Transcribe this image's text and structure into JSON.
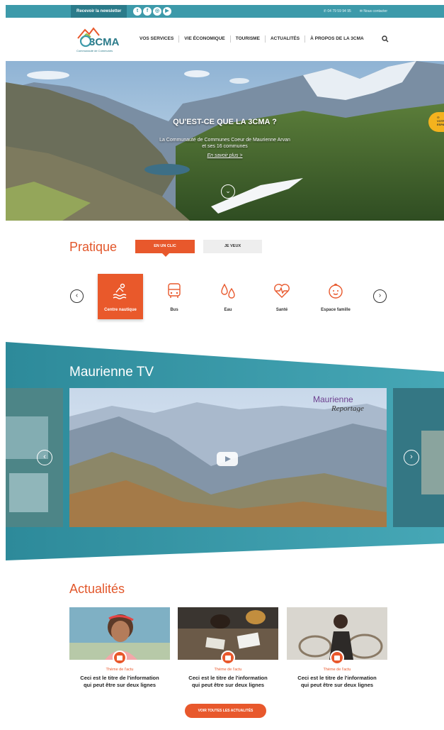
{
  "topbar": {
    "newsletter": "Recevoir la newsletter",
    "socials": [
      {
        "icon": "twitter-icon",
        "glyph": "t"
      },
      {
        "icon": "facebook-icon",
        "glyph": "f"
      },
      {
        "icon": "instagram-icon",
        "glyph": "◎"
      },
      {
        "icon": "youtube-icon",
        "glyph": "▶"
      }
    ],
    "phone": "04 79 59 94 95",
    "contact": "Nous contacter"
  },
  "header": {
    "logo_text": "3CMA",
    "logo_sub": "Communauté de Communes",
    "nav": [
      "VOS SERVICES",
      "VIE ÉCONOMIQUE",
      "TOURISME",
      "ACTUALITÉS",
      "À PROPOS DE LA 3CMA"
    ]
  },
  "hero": {
    "title": "QU'EST-CE QUE LA 3CMA ?",
    "text_line1": "La Communauté de Communes Coeur de Maurienne Arvan",
    "text_line2": "et ses 16 communes",
    "link": "En savoir plus >",
    "espace_label": "VOTRE ESPACE"
  },
  "pratique": {
    "title": "Pratique",
    "tab_active": "EN UN CLIC",
    "tab_other": "JE VEUX",
    "services": [
      {
        "label": "Centre nautique",
        "icon": "swimmer-icon",
        "active": true
      },
      {
        "label": "Bus",
        "icon": "bus-icon",
        "active": false
      },
      {
        "label": "Eau",
        "icon": "water-drops-icon",
        "active": false
      },
      {
        "label": "Santé",
        "icon": "heart-pulse-icon",
        "active": false
      },
      {
        "label": "Espace famille",
        "icon": "baby-face-icon",
        "active": false
      }
    ]
  },
  "tv": {
    "title": "Maurienne TV",
    "brand_line1": "Maurienne",
    "brand_line2": "Reportage"
  },
  "actualites": {
    "title": "Actualités",
    "cards": [
      {
        "theme": "Thème de l'actu",
        "title_line1": "Ceci est le titre de l'information",
        "title_line2": "qui peut être sur deux lignes",
        "badge_icon": "contact-card-icon"
      },
      {
        "theme": "Thème de l'actu",
        "title_line1": "Ceci est le titre de l'information",
        "title_line2": "qui peut être sur deux lignes",
        "badge_icon": "youtube-icon"
      },
      {
        "theme": "Thème de l'actu",
        "title_line1": "Ceci est le titre de l'information",
        "title_line2": "qui peut être sur deux lignes",
        "badge_icon": "instagram-icon"
      }
    ],
    "all_button": "VOIR TOUTES LES ACTUALITÉS"
  },
  "colors": {
    "teal": "#3d9aaa",
    "teal_dark": "#2b7b8a",
    "orange": "#e8582c",
    "yellow": "#f4b21e"
  }
}
